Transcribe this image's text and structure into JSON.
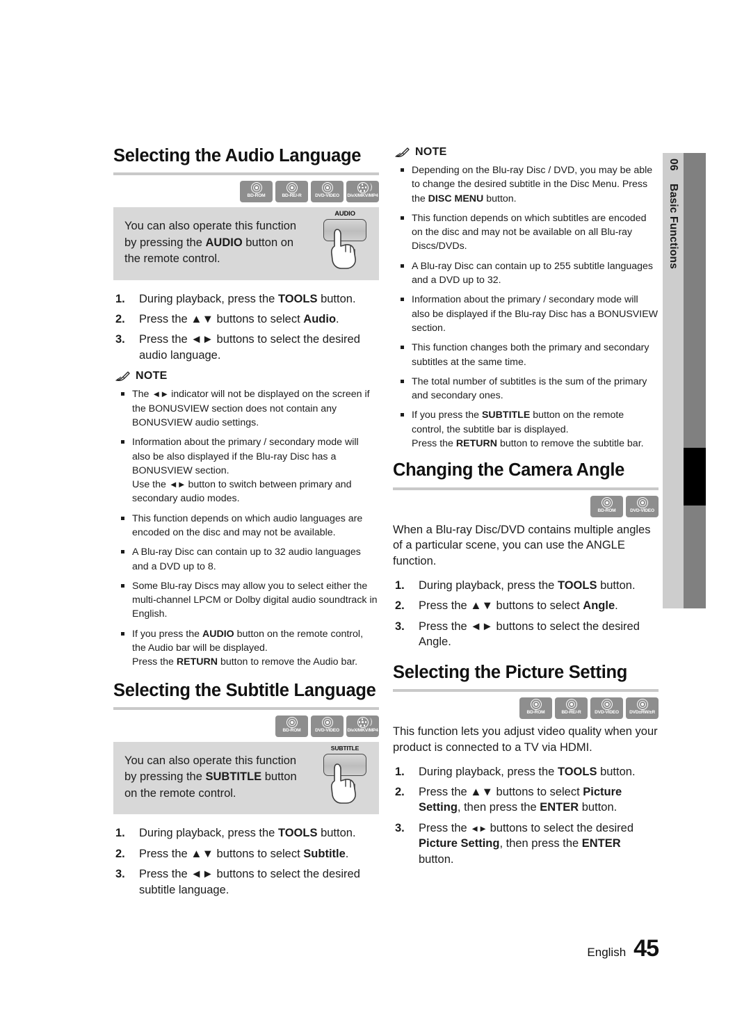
{
  "sidetab": {
    "number": "06",
    "label": "Basic Functions"
  },
  "footer": {
    "language": "English",
    "page": "45"
  },
  "note_heading": "NOTE",
  "left_column": {
    "audio_section": {
      "title": "Selecting the Audio Language",
      "badges": [
        {
          "label": "BD-ROM",
          "icon": "disc-icon"
        },
        {
          "label": "BD-RE/-R",
          "icon": "disc-icon"
        },
        {
          "label": "DVD-VIDEO",
          "icon": "disc-icon"
        },
        {
          "label": "DivX/MKV/MP4",
          "icon": "film-reel-icon"
        }
      ],
      "tip": {
        "text_1": "You can also operate this function by pressing the ",
        "bold": "AUDIO",
        "text_2": " button on the remote control.",
        "remote_key_label": "AUDIO"
      },
      "steps": [
        {
          "n": "1.",
          "t1": "During playback, press the ",
          "b": "TOOLS",
          "t2": " button."
        },
        {
          "n": "2.",
          "t1": "Press the ▲▼ buttons to select ",
          "b": "Audio",
          "t2": "."
        },
        {
          "n": "3.",
          "t1": "Press the ◄► buttons to select the desired audio language.",
          "b": "",
          "t2": ""
        }
      ],
      "notes": [
        "The ◄► indicator will not be displayed on the screen if the BONUSVIEW section does not contain any BONUSVIEW audio settings.",
        "Information about the primary / secondary mode will also be also displayed if the Blu-ray Disc has a BONUSVIEW section. Use the ◄► button to switch between primary and secondary audio modes.",
        "This function depends on which audio languages are encoded on the disc and may not be available.",
        "A Blu-ray Disc can contain up to 32 audio languages and a DVD up to 8.",
        "Some Blu-ray Discs may allow you to select either the multi-channel LPCM or Dolby digital audio soundtrack in English.",
        "If you press the AUDIO button on the remote control, the Audio bar will be displayed. Press the RETURN button to remove the Audio bar."
      ]
    },
    "subtitle_section": {
      "title": "Selecting the Subtitle Language",
      "badges": [
        {
          "label": "BD-ROM",
          "icon": "disc-icon"
        },
        {
          "label": "DVD-VIDEO",
          "icon": "disc-icon"
        },
        {
          "label": "DivX/MKV/MP4",
          "icon": "film-reel-icon"
        }
      ],
      "tip": {
        "text_1": "You can also operate this function by pressing the ",
        "bold": "SUBTITLE",
        "text_2": " button on the remote control.",
        "remote_key_label": "SUBTITLE"
      },
      "steps": [
        {
          "n": "1.",
          "t1": "During playback, press the ",
          "b": "TOOLS",
          "t2": " button."
        },
        {
          "n": "2.",
          "t1": "Press the ▲▼ buttons to select ",
          "b": "Subtitle",
          "t2": "."
        },
        {
          "n": "3.",
          "t1": "Press the ◄► buttons to select the desired subtitle language.",
          "b": "",
          "t2": ""
        }
      ]
    }
  },
  "right_column": {
    "subtitle_notes": [
      "Depending on the Blu-ray Disc / DVD, you may be able to change the desired subtitle in the Disc Menu. Press the DISC MENU button.",
      "This function depends on which subtitles are encoded on the disc and may not be available on all Blu-ray Discs/DVDs.",
      "A Blu-ray Disc can contain up to 255 subtitle languages and a DVD up to 32.",
      "Information about the primary / secondary mode will also be displayed if the Blu-ray Disc has a BONUSVIEW section.",
      "This function changes both the primary and secondary subtitles at the same time.",
      "The total number of subtitles is the sum of the primary and secondary ones.",
      "If you press the SUBTITLE button on the remote control, the subtitle bar is displayed. Press the RETURN button to remove the subtitle bar."
    ],
    "angle_section": {
      "title": "Changing the Camera Angle",
      "badges": [
        {
          "label": "BD-ROM",
          "icon": "disc-icon"
        },
        {
          "label": "DVD-VIDEO",
          "icon": "disc-icon"
        }
      ],
      "intro": "When a Blu-ray Disc/DVD contains multiple angles of a particular scene, you can use the ANGLE function.",
      "steps": [
        {
          "n": "1.",
          "t1": "During playback, press the ",
          "b": "TOOLS",
          "t2": " button."
        },
        {
          "n": "2.",
          "t1": "Press the ▲▼ buttons to select ",
          "b": "Angle",
          "t2": "."
        },
        {
          "n": "3.",
          "t1": "Press the ◄► buttons to select the desired Angle.",
          "b": "",
          "t2": ""
        }
      ]
    },
    "picture_section": {
      "title": "Selecting the Picture Setting",
      "badges": [
        {
          "label": "BD-ROM",
          "icon": "disc-icon"
        },
        {
          "label": "BD-RE/-R",
          "icon": "disc-icon"
        },
        {
          "label": "DVD-VIDEO",
          "icon": "disc-icon"
        },
        {
          "label": "DVD±RW/±R",
          "icon": "disc-icon"
        }
      ],
      "intro": "This function lets you adjust video quality when your product is connected to a TV via HDMI.",
      "steps": [
        {
          "n": "1.",
          "t1": "During playback, press the ",
          "b": "TOOLS",
          "t2": " button."
        },
        {
          "n": "2.",
          "t1": "Press the ▲▼ buttons to select ",
          "b": "Picture Setting",
          "t2": ", then press the ENTER button."
        },
        {
          "n": "3.",
          "t1": "Press the ◄► buttons to select the desired Picture Setting, then press the ENTER button.",
          "b": "",
          "t2": ""
        }
      ]
    }
  },
  "colors": {
    "rule": "#c9c9c9",
    "tipbox_bg": "#d8d8d8",
    "badge_bg": "#8e8e8e",
    "sidetab_light": "#cdcdcd",
    "sidetab_dark": "#808080",
    "sidetab_mark": "#000000"
  }
}
